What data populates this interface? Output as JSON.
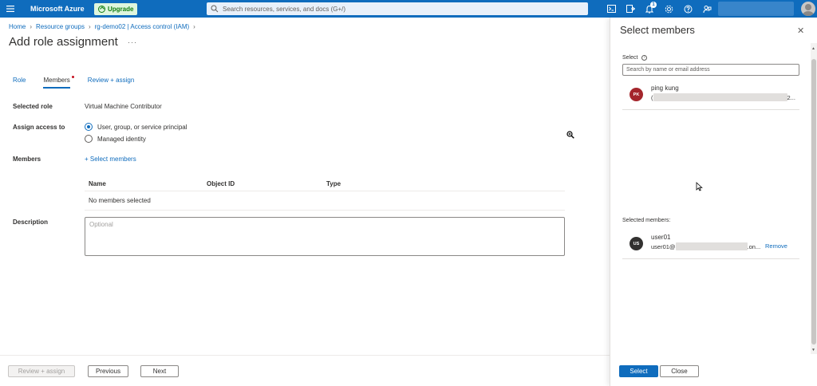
{
  "topbar": {
    "brand": "Microsoft Azure",
    "upgrade_label": "Upgrade",
    "search_placeholder": "Search resources, services, and docs (G+/)",
    "notification_count": "1",
    "accent": "#0f6cbd"
  },
  "breadcrumb": {
    "items": [
      "Home",
      "Resource groups",
      "rg-demo02 | Access control (IAM)"
    ]
  },
  "page": {
    "title": "Add role assignment",
    "more": "···"
  },
  "tabs": [
    {
      "label": "Role"
    },
    {
      "label": "Members"
    },
    {
      "label": "Review + assign"
    }
  ],
  "form": {
    "selected_role_label": "Selected role",
    "selected_role_value": "Virtual Machine Contributor",
    "assign_access_label": "Assign access to",
    "option_user": "User, group, or service principal",
    "option_mi": "Managed identity",
    "members_label": "Members",
    "select_members_link": "+ Select members",
    "description_label": "Description",
    "description_placeholder": "Optional"
  },
  "grid": {
    "columns": [
      "Name",
      "Object ID",
      "Type"
    ],
    "empty_text": "No members selected"
  },
  "footer": {
    "review_assign": "Review + assign",
    "previous": "Previous",
    "next": "Next"
  },
  "panel": {
    "title": "Select members",
    "select_label": "Select",
    "search_placeholder": "Search by name or email address",
    "results": [
      {
        "initials": "PK",
        "name": "ping kung",
        "detail_prefix": "(",
        "detail_suffix": "2...",
        "color": "#a4262c"
      }
    ],
    "selected_label": "Selected members:",
    "selected": [
      {
        "initials": "US",
        "name": "user01",
        "detail_prefix": "user01@",
        "detail_suffix": ".on...",
        "remove": "Remove",
        "color": "#323130"
      }
    ],
    "select_button": "Select",
    "close_button": "Close"
  }
}
